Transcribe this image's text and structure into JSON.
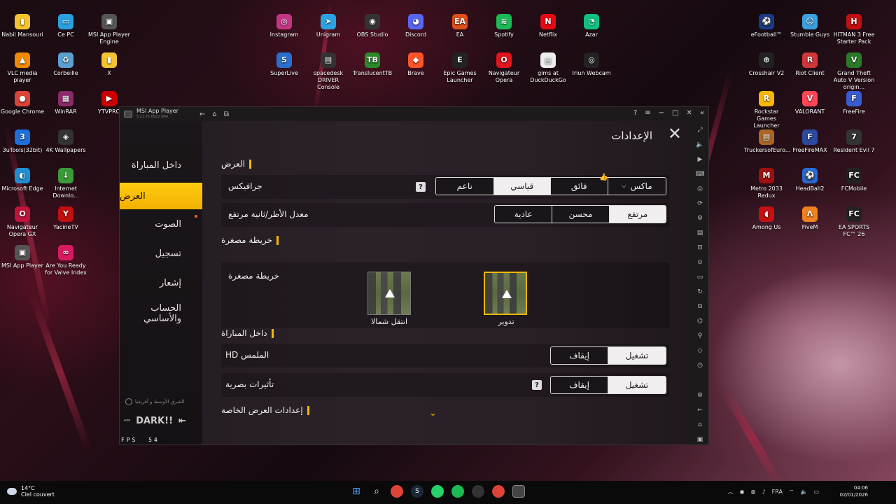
{
  "desktop": {
    "left_icons": [
      {
        "label": "Nabil Mansouri",
        "color": "#f4c430",
        "glyph": "▮"
      },
      {
        "label": "Ce PC",
        "color": "#2aa0e0",
        "glyph": "▭"
      },
      {
        "label": "MSI App Player Engine",
        "color": "#555",
        "glyph": "▣"
      },
      {
        "label": "VLC media player",
        "color": "#f08a00",
        "glyph": "▲"
      },
      {
        "label": "Corbeille",
        "color": "#5aa0d0",
        "glyph": "♻"
      },
      {
        "label": "X",
        "color": "#f4c430",
        "glyph": "▮"
      },
      {
        "label": "Google Chrome",
        "color": "#db4437",
        "glyph": "●"
      },
      {
        "label": "WinRAR",
        "color": "#8a2a6a",
        "glyph": "▦"
      },
      {
        "label": "YTVPRO",
        "color": "#c00",
        "glyph": "▶"
      },
      {
        "label": "3uTools(32bit)",
        "color": "#1e6fd9",
        "glyph": "3"
      },
      {
        "label": "4K Wallpapers",
        "color": "#333",
        "glyph": "◈"
      },
      {
        "label": "Microsoft Edge",
        "color": "#1d8fd0",
        "glyph": "◐"
      },
      {
        "label": "Internet Downlo...",
        "color": "#3a9a3a",
        "glyph": "↓"
      },
      {
        "label": "Navigateur Opera GX",
        "color": "#c0143c",
        "glyph": "O"
      },
      {
        "label": "YacineTV",
        "color": "#c01010",
        "glyph": "Y"
      },
      {
        "label": "MSI App Player",
        "color": "#555",
        "glyph": "▣"
      },
      {
        "label": "Are You Ready for Valve Index",
        "color": "#d81b60",
        "glyph": "∞"
      }
    ],
    "top_icons": [
      {
        "label": "Instagram",
        "color": "#c13584",
        "glyph": "◎"
      },
      {
        "label": "Unigram",
        "color": "#2aa3e0",
        "glyph": "➤"
      },
      {
        "label": "OBS Studio",
        "color": "#333",
        "glyph": "◉"
      },
      {
        "label": "Discord",
        "color": "#5865f2",
        "glyph": "◕"
      },
      {
        "label": "EA",
        "color": "#e0501a",
        "glyph": "EA"
      },
      {
        "label": "Spotify",
        "color": "#1db954",
        "glyph": "≋"
      },
      {
        "label": "Netflix",
        "color": "#e50914",
        "glyph": "N"
      },
      {
        "label": "Azar",
        "color": "#10c080",
        "glyph": "◔"
      },
      {
        "label": "SuperLive",
        "color": "#2a6fd0",
        "glyph": "S"
      },
      {
        "label": "spacedesk DRIVER Console",
        "color": "#333",
        "glyph": "▤"
      },
      {
        "label": "TranslucentTB",
        "color": "#2a8a2a",
        "glyph": "TB"
      },
      {
        "label": "Brave",
        "color": "#fb542b",
        "glyph": "◆"
      },
      {
        "label": "Epic Games Launcher",
        "color": "#222",
        "glyph": "E"
      },
      {
        "label": "Navigateur Opera",
        "color": "#e0141c",
        "glyph": "O"
      },
      {
        "label": "gims at DuckDuckGo",
        "color": "#eee",
        "glyph": "▤"
      },
      {
        "label": "Iriun Webcam",
        "color": "#222",
        "glyph": "◎"
      }
    ],
    "right_icons": [
      {
        "label": "eFootball™",
        "color": "#1a3a8a",
        "glyph": "⚽"
      },
      {
        "label": "Stumble Guys",
        "color": "#3aa0e0",
        "glyph": "☺"
      },
      {
        "label": "HITMAN 3 Free Starter Pack",
        "color": "#c01010",
        "glyph": "H"
      },
      {
        "label": "Crosshair V2",
        "color": "#222",
        "glyph": "⊕"
      },
      {
        "label": "Riot Client",
        "color": "#d13639",
        "glyph": "R"
      },
      {
        "label": "Grand Theft Auto V Version origin...",
        "color": "#2a7a2a",
        "glyph": "V"
      },
      {
        "label": "Rockstar Games Launcher",
        "color": "#f8b800",
        "glyph": "R"
      },
      {
        "label": "VALORANT",
        "color": "#ff4655",
        "glyph": "V"
      },
      {
        "label": "FreeFire",
        "color": "#3a5ad0",
        "glyph": "F"
      },
      {
        "label": "TruckersofEuro...",
        "color": "#aa6622",
        "glyph": "▤"
      },
      {
        "label": "FreeFireMAX",
        "color": "#2a4aa0",
        "glyph": "F"
      },
      {
        "label": "Resident Evil 7",
        "color": "#333",
        "glyph": "7"
      },
      {
        "label": "Metro 2033 Redux",
        "color": "#a01010",
        "glyph": "M"
      },
      {
        "label": "HeadBall2",
        "color": "#2a6ad0",
        "glyph": "⚽"
      },
      {
        "label": "FCMobile",
        "color": "#222",
        "glyph": "FC"
      },
      {
        "label": "Among Us",
        "color": "#c51111",
        "glyph": "◖"
      },
      {
        "label": "FiveM",
        "color": "#f08020",
        "glyph": "Λ"
      },
      {
        "label": "EA SPORTS FC™ 26",
        "color": "#222",
        "glyph": "FC"
      }
    ]
  },
  "window": {
    "title": "MSI App Player",
    "subtitle": "5.21.75.6822 N64"
  },
  "game": {
    "settings_title": "الإعدادات",
    "menu": {
      "match": "داخل المباراة",
      "display": "العرض",
      "sound": "الصوت",
      "register": "تسجيل",
      "notification": "إشعار",
      "account": "الحساب والأساسي"
    },
    "region": "الشرق الأوسط و أفريقيا",
    "logo": "DARK!!",
    "logo_small": "⁴²⁰",
    "fps_label": "FPS",
    "fps_value": "54",
    "sections": {
      "display": "العرض",
      "minimap": "خريطة مصغرة",
      "in_match": "داخل المباراة",
      "custom_display": "إعدادات العرض الخاصة"
    },
    "graphics": {
      "label": "جرافيكس",
      "options": [
        "ماكس",
        "فائق",
        "قياسي",
        "ناعم"
      ],
      "selected": "قياسي"
    },
    "framerate": {
      "label": "معدل الأطر/ثانية مرتفع",
      "options": [
        "مرتفع",
        "محسن",
        "عادية"
      ],
      "selected": "مرتفع"
    },
    "minimap": {
      "label": "خريطة مصغرة",
      "option_rotate": "تدوير",
      "option_north": "انتقل شمالا"
    },
    "hd_touch": {
      "label": "الملمس HD",
      "on": "تشغيل",
      "off": "إيقاف"
    },
    "visual_effects": {
      "label": "تأثيرات بصرية",
      "on": "تشغيل",
      "off": "إيقاف"
    }
  },
  "taskbar": {
    "temperature": "14°C",
    "weather": "Ciel couvert",
    "lang": "FRA",
    "time": "04:06",
    "date": "02/01/2026"
  }
}
